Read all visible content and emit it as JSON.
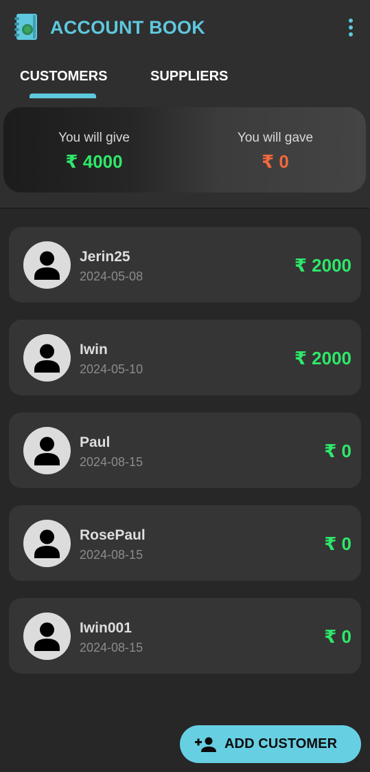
{
  "app": {
    "title": "ACCOUNT BOOK",
    "logo_icon": "book-icon",
    "menu_icon": "more-vert-icon"
  },
  "tabs": [
    {
      "label": "CUSTOMERS",
      "active": true
    },
    {
      "label": "SUPPLIERS",
      "active": false
    }
  ],
  "summary": {
    "give": {
      "label": "You will give",
      "value": "₹ 4000"
    },
    "gave": {
      "label": "You will gave",
      "value": "₹ 0"
    }
  },
  "customers": [
    {
      "name": "Jerin25",
      "date": "2024-05-08",
      "amount": "₹ 2000"
    },
    {
      "name": "Iwin",
      "date": "2024-05-10",
      "amount": "₹ 2000"
    },
    {
      "name": "Paul",
      "date": "2024-08-15",
      "amount": "₹ 0"
    },
    {
      "name": "RosePaul",
      "date": "2024-08-15",
      "amount": "₹ 0"
    },
    {
      "name": "Iwin001",
      "date": "2024-08-15",
      "amount": "₹ 0"
    }
  ],
  "fab": {
    "label": "ADD CUSTOMER",
    "icon": "person-add-icon"
  },
  "colors": {
    "accent": "#5ec8de",
    "positive": "#2ee86a",
    "negative": "#f2683c",
    "background": "#272727",
    "card": "#353535"
  }
}
